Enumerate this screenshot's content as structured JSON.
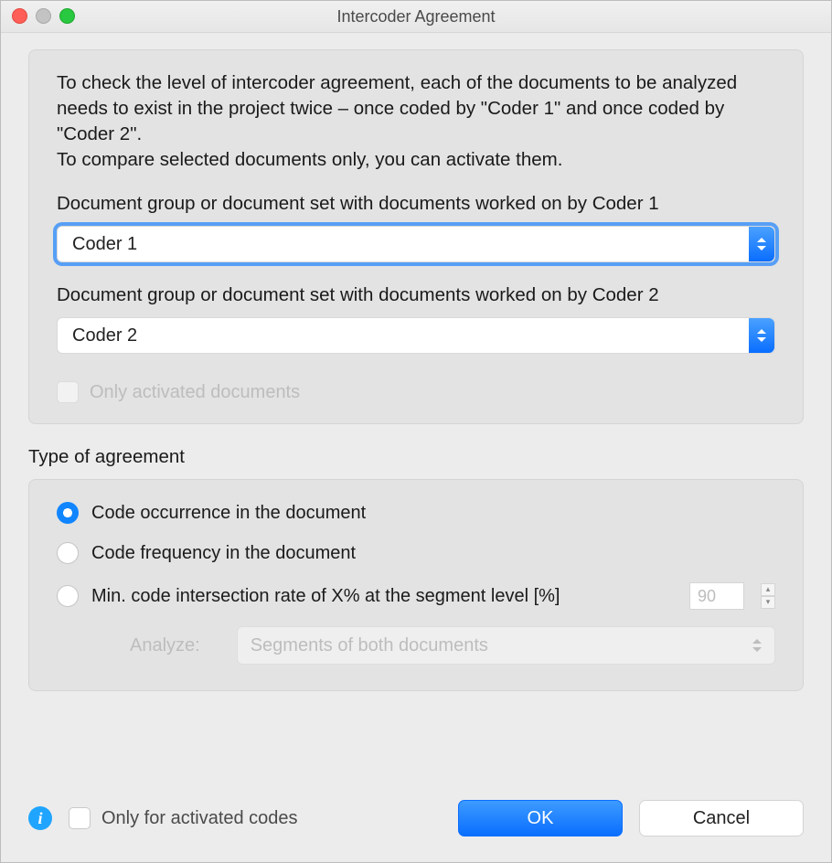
{
  "window": {
    "title": "Intercoder Agreement"
  },
  "intro_line1": "To check the level of intercoder agreement, each of the documents to be analyzed needs to exist in the project twice – once coded by \"Coder 1\" and once coded by \"Coder 2\".",
  "intro_line2": "To compare selected documents only, you can activate them.",
  "coder1": {
    "label": "Document group or document set with documents worked on by Coder 1",
    "value": "Coder 1"
  },
  "coder2": {
    "label": "Document group or document set with documents worked on by Coder 2",
    "value": "Coder 2"
  },
  "only_activated_docs": "Only activated documents",
  "section_title": "Type of agreement",
  "radios": {
    "r1": "Code occurrence in the document",
    "r2": "Code frequency in the document",
    "r3": "Min. code intersection rate of X% at the segment level [%]",
    "r3_value": "90"
  },
  "analyze": {
    "label": "Analyze:",
    "value": "Segments of both documents"
  },
  "footer": {
    "only_activated_codes": "Only for activated codes",
    "ok": "OK",
    "cancel": "Cancel"
  }
}
